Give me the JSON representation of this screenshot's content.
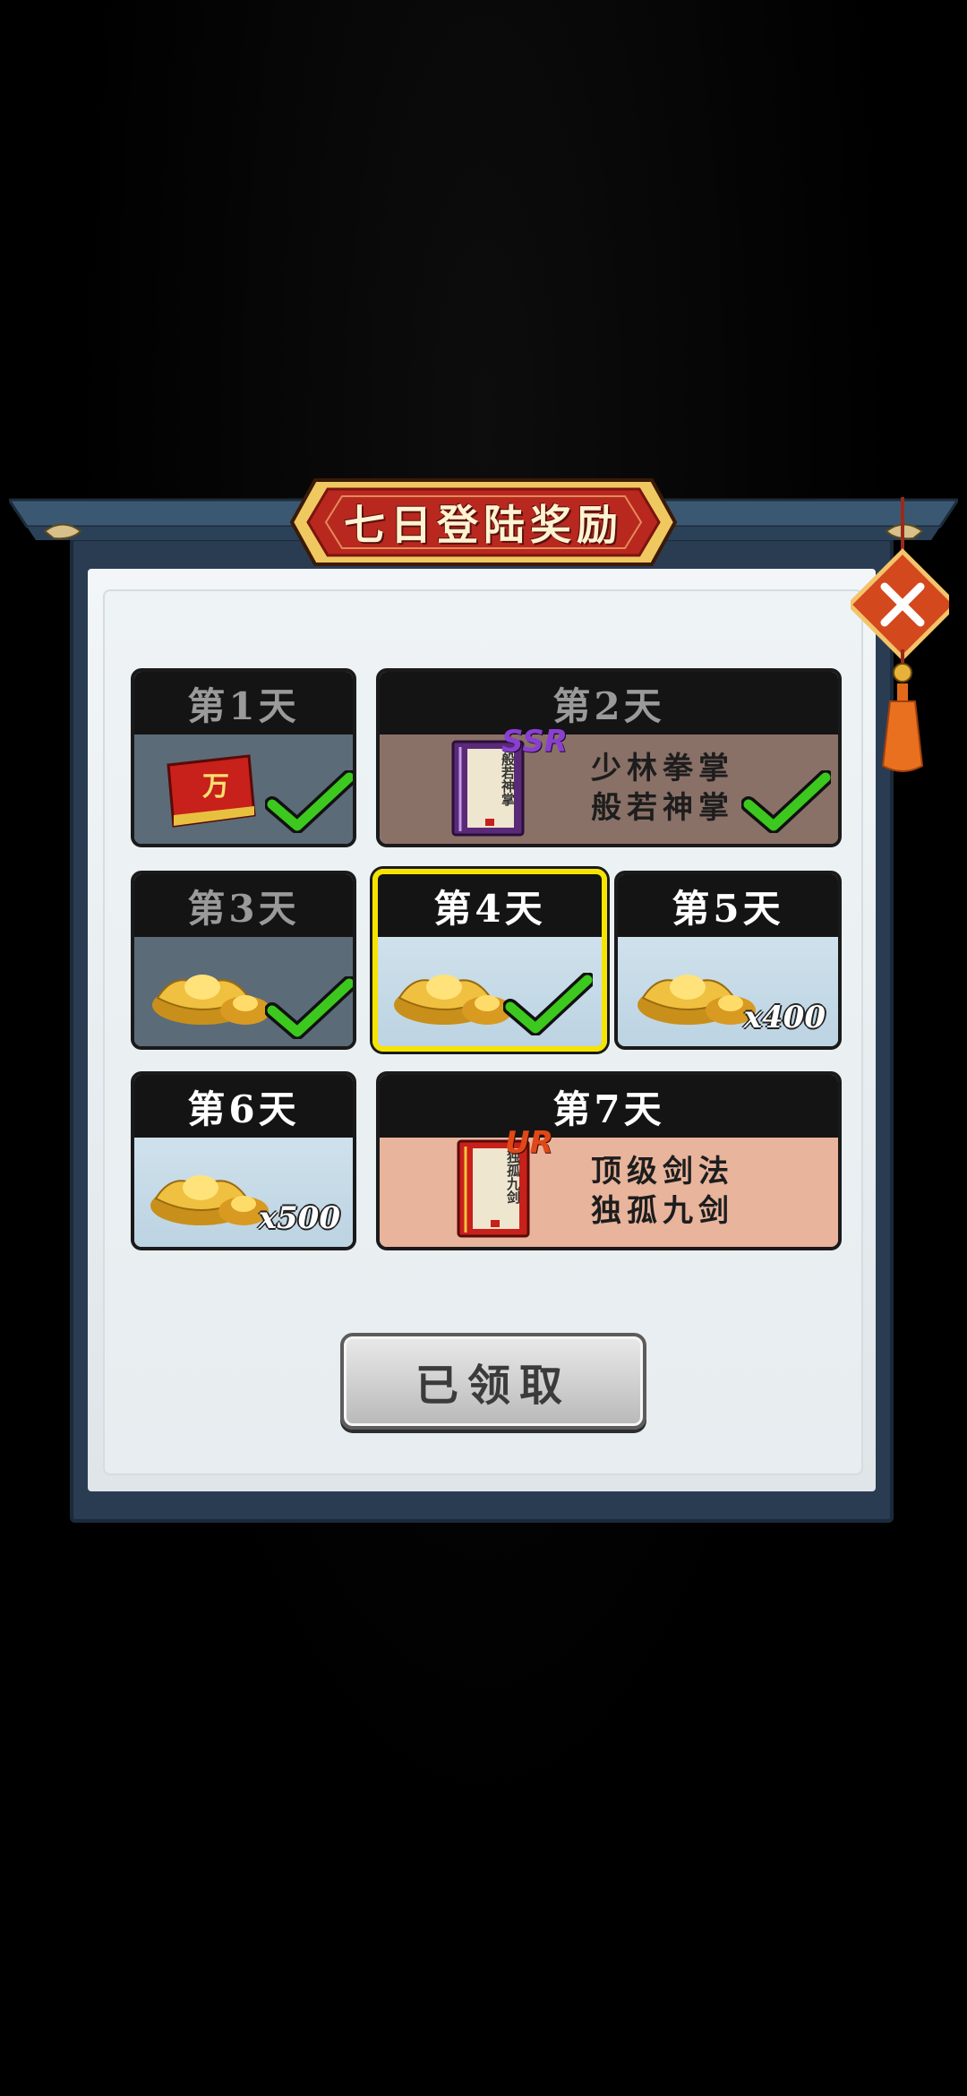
{
  "title": "七日登陆奖励",
  "days": [
    {
      "label": "第1天",
      "qty": "",
      "claimed": true
    },
    {
      "label": "第2天",
      "rarity": "SSR",
      "item_line1": "少林拳掌",
      "item_line2": "般若神掌",
      "book_text": "般若神掌",
      "claimed": true
    },
    {
      "label": "第3天",
      "qty": "",
      "claimed": true
    },
    {
      "label": "第4天",
      "qty": "",
      "claimed": true
    },
    {
      "label": "第5天",
      "qty": "x400",
      "claimed": false
    },
    {
      "label": "第6天",
      "qty": "x500",
      "claimed": false
    },
    {
      "label": "第7天",
      "rarity": "UR",
      "item_line1": "顶级剑法",
      "item_line2": "独孤九剑",
      "book_text": "独孤九剑",
      "claimed": false
    }
  ],
  "day1_item_glyph": "万",
  "claim_button": "已领取",
  "colors": {
    "title_plaque": "#b8281e",
    "selected_border": "#f6e400",
    "check_green": "#3cc81e",
    "ssr": "#8a3fd0",
    "ur": "#e04818"
  },
  "icons": [
    "red-envelope-icon",
    "gold-ingot-icon",
    "skill-book-icon",
    "check-icon",
    "close-icon"
  ]
}
